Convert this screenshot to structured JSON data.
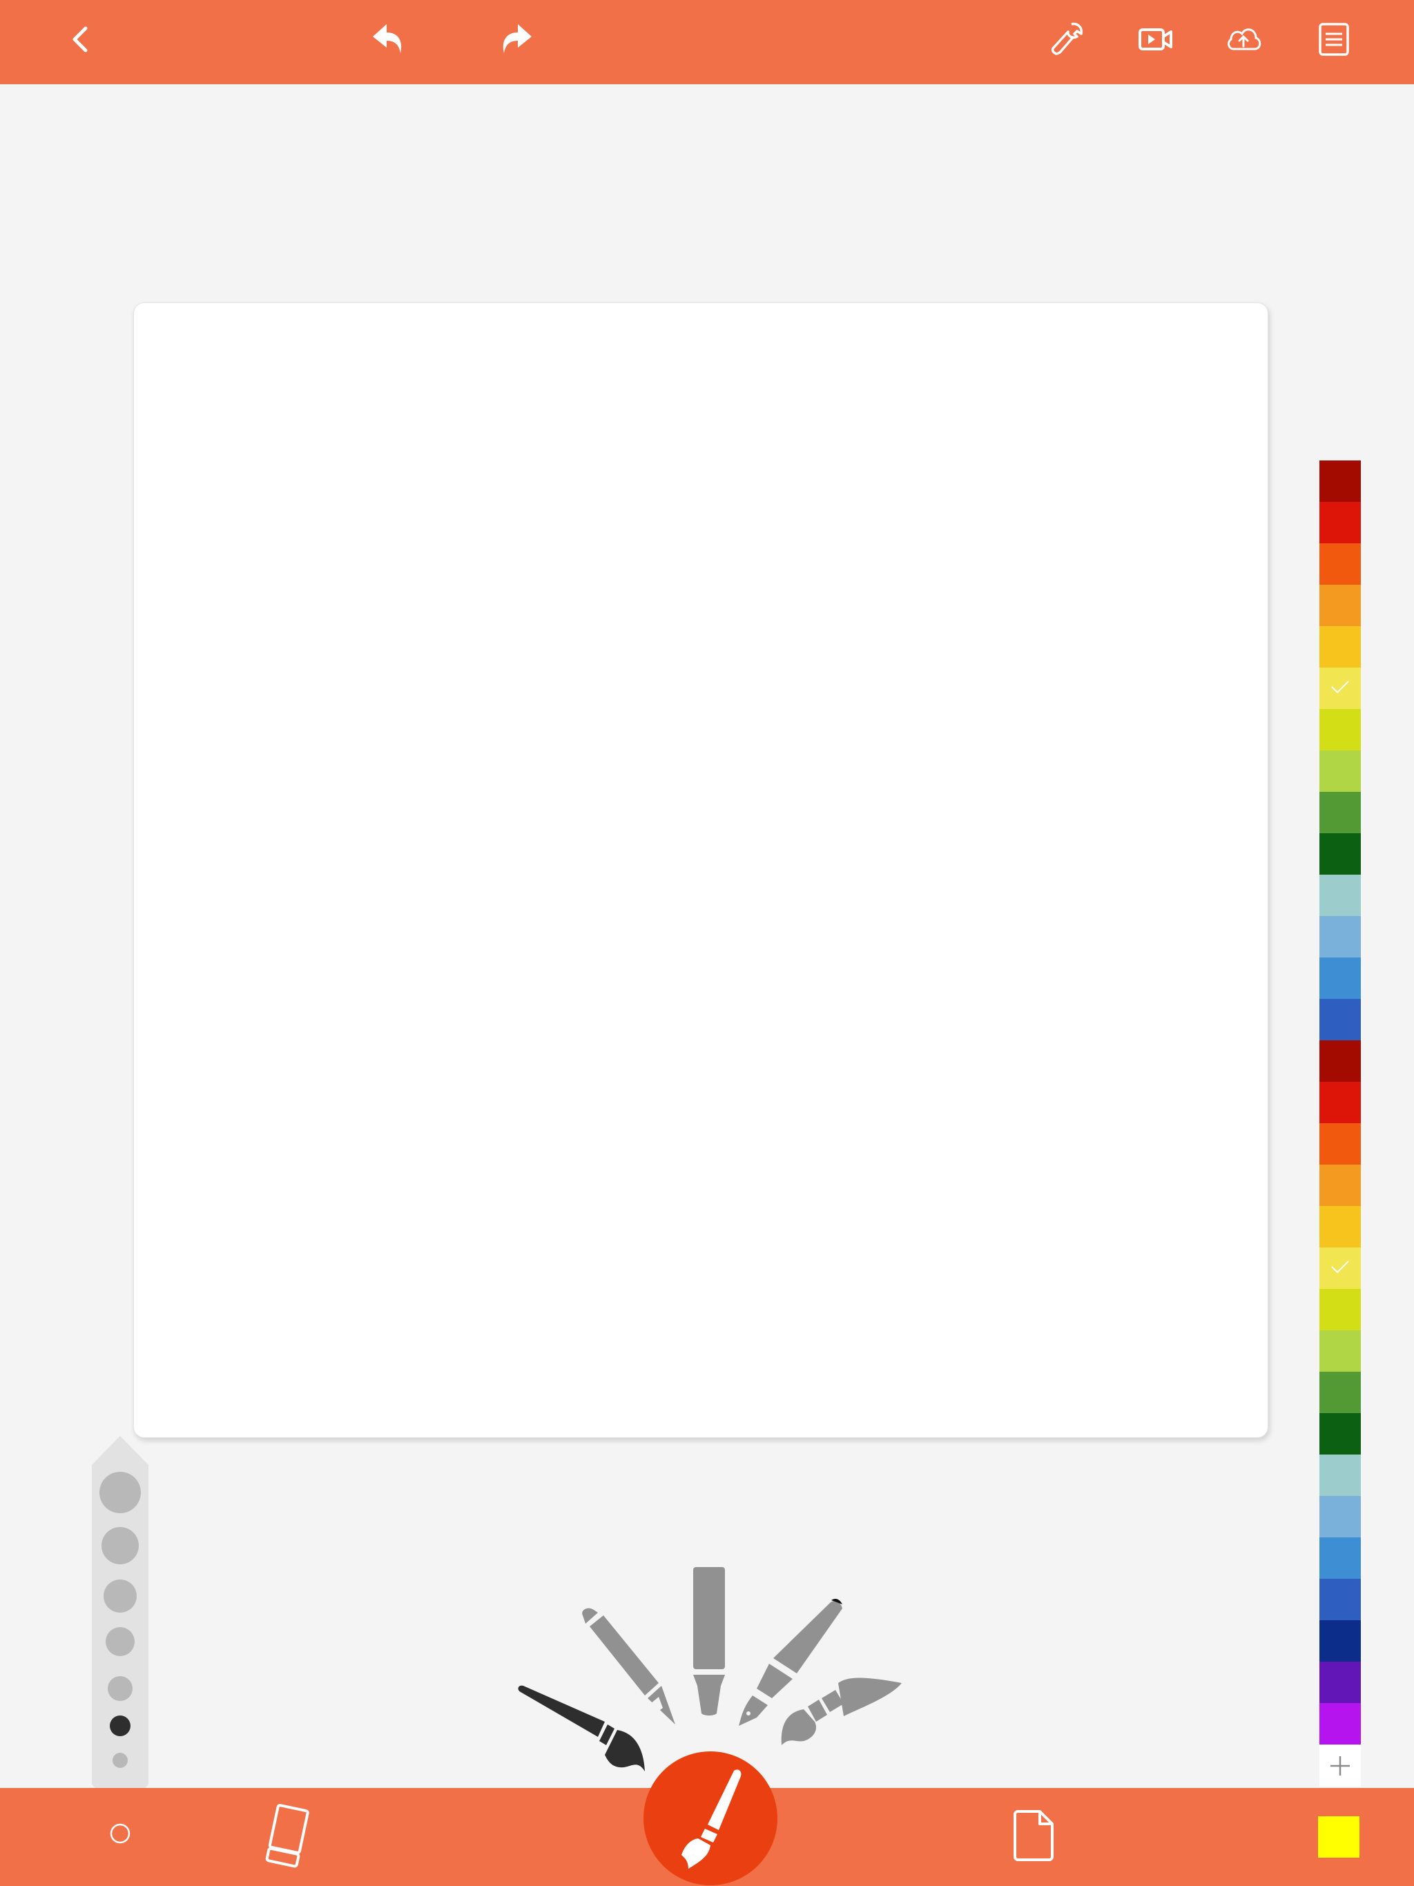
{
  "toolbar": {
    "icons": [
      "back-icon",
      "undo-icon",
      "redo-icon",
      "wrench-icon",
      "video-icon",
      "cloud-upload-icon",
      "menu-list-icon"
    ],
    "background": "#f27047"
  },
  "palette": {
    "colors": [
      "#a30a00",
      "#dd1508",
      "#f15a0e",
      "#f59a21",
      "#f7c41e",
      "#f2e552",
      "#d4de16",
      "#b0d646",
      "#539a34",
      "#0b6011",
      "#9ccdcc",
      "#7ab1da",
      "#3e8ed3",
      "#2f5ec1",
      "#a30a00",
      "#dd1508",
      "#f15a0e",
      "#f59a21",
      "#f7c41e",
      "#f2e552",
      "#d4de16",
      "#b0d646",
      "#539a34",
      "#0b6011",
      "#9ccdcc",
      "#7ab1da",
      "#3e8ed3",
      "#2f5ec1",
      "#0c2d8a",
      "#6316b8",
      "#b514ef"
    ],
    "checked_indices": [
      5,
      19
    ],
    "add_icon": "plus-icon"
  },
  "brush_sizes": {
    "count": 7,
    "selected_index": 5
  },
  "brushes": {
    "icons": [
      "paintbrush-icon",
      "calligraphy-pen-icon",
      "marker-icon",
      "fountain-pen-icon",
      "watercolor-brush-icon"
    ],
    "selected_index": 0
  },
  "bottom": {
    "icons": [
      "size-circle-icon",
      "eraser-icon",
      "brush-fab-icon",
      "new-page-icon"
    ],
    "current_color": "#ffff00",
    "fab_color": "#ea3f10"
  }
}
